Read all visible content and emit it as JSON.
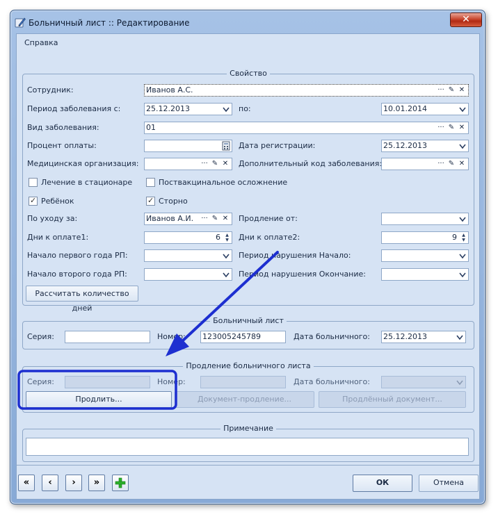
{
  "window": {
    "title": "Больничный лист :: Редактирование"
  },
  "menu": {
    "items": [
      "Справка"
    ]
  },
  "property_group": {
    "title": "Свойство",
    "employee_label": "Сотрудник:",
    "employee_value": "Иванов А.С.",
    "illness_from_label": "Период заболевания с:",
    "illness_from_value": "25.12.2013",
    "to_label": "по:",
    "to_value": "10.01.2014",
    "illness_type_label": "Вид заболевания:",
    "illness_type_value": "01",
    "payment_percent_label": "Процент оплаты:",
    "payment_percent_value": "",
    "registration_date_label": "Дата регистрации:",
    "registration_date_value": "25.12.2013",
    "medical_org_label": "Медицинская организация:",
    "additional_code_label": "Дополнительный код заболевания:",
    "inpatient_label": "Лечение в стационаре",
    "inpatient_checked": false,
    "post_vaccination_label": "Поствакцинальное  осложнение",
    "post_vaccination_checked": false,
    "child_label": "Ребёнок",
    "child_checked": true,
    "storno_label": "Сторно",
    "storno_checked": true,
    "care_for_label": "По уходу за:",
    "care_for_value": "Иванов А.И.",
    "extension_from_label": "Продление от:",
    "days_to_pay1_label": "Дни к оплате1:",
    "days_to_pay1_value": "6",
    "days_to_pay2_label": "Дни к оплате2:",
    "days_to_pay2_value": "9",
    "rp_year1_label": "Начало первого года РП:",
    "violation_start_label": "Период нарушения Начало:",
    "rp_year2_label": "Начало второго года РП:",
    "violation_end_label": "Период нарушения Окончание:",
    "calc_days_button": "Рассчитать количество дней"
  },
  "sick_leave_group": {
    "title": "Больничный лист",
    "series_label": "Серия:",
    "series_value": "",
    "number_label": "Номер:",
    "number_value": "123005245789",
    "date_label": "Дата больничного:",
    "date_value": "25.12.2013"
  },
  "extension_group": {
    "title": "Продление больничного листа",
    "series_label": "Серия:",
    "number_label": "Номер:",
    "date_label": "Дата больничного:",
    "extend_button": "Продлить...",
    "extension_doc_button": "Документ-продление...",
    "extended_doc_button": "Продлённый документ..."
  },
  "note_group": {
    "title": "Примечание",
    "value": ""
  },
  "nav": {
    "first": "«",
    "prev": "‹",
    "next": "›",
    "last": "»",
    "add": "+"
  },
  "actions": {
    "ok": "ОК",
    "cancel": "Отмена"
  },
  "icons": {
    "app": "pencil-app-icon",
    "close": "close-icon",
    "ellipsis": "ellipsis-icon",
    "edit": "edit-pencil-icon",
    "clear": "clear-x-icon",
    "calculator": "calculator-icon",
    "dropdown": "chevron-down-icon",
    "add": "plus-icon"
  },
  "colors": {
    "annotation": "#1d2fd0",
    "add_icon": "#2bb02b",
    "window_frame": "#a6c2e6",
    "client_bg": "#d6e3f4"
  }
}
